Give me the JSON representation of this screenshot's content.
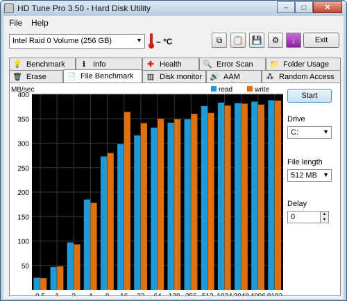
{
  "window": {
    "title": "HD Tune Pro 3.50 - Hard Disk Utility",
    "minimize": "–",
    "maximize": "□",
    "close": "✕"
  },
  "menu": [
    {
      "label": "File"
    },
    {
      "label": "Help"
    }
  ],
  "toolbar": {
    "drive": "Intel   Raid 0 Volume (256 GB)",
    "temperature": "– °C",
    "exit_label": "Exit"
  },
  "tabs_top": [
    {
      "label": "Benchmark",
      "icon": "lightbulb-icon"
    },
    {
      "label": "Info",
      "icon": "info-icon"
    },
    {
      "label": "Health",
      "icon": "health-cross-icon"
    },
    {
      "label": "Error Scan",
      "icon": "magnifier-icon"
    },
    {
      "label": "Folder Usage",
      "icon": "folder-icon"
    }
  ],
  "tabs_bottom": [
    {
      "label": "Erase",
      "icon": "trash-icon"
    },
    {
      "label": "File Benchmark",
      "icon": "file-icon"
    },
    {
      "label": "Disk monitor",
      "icon": "monitor-icon"
    },
    {
      "label": "AAM",
      "icon": "speaker-icon"
    },
    {
      "label": "Random Access",
      "icon": "random-icon"
    }
  ],
  "active_tab": "File Benchmark",
  "controls": {
    "start_label": "Start",
    "drive_label": "Drive",
    "drive_value": "C:",
    "file_length_label": "File length",
    "file_length_value": "512 MB",
    "delay_label": "Delay",
    "delay_value": "0"
  },
  "colors": {
    "read": "#1e9ad6",
    "write": "#e0700d",
    "plot_bg": "#000000"
  },
  "chart_data": {
    "type": "bar",
    "ylabel": "MB/sec",
    "ylim": [
      0,
      400
    ],
    "yticks": [
      50,
      100,
      150,
      200,
      250,
      300,
      350,
      400
    ],
    "categories": [
      "0.5",
      "1",
      "2",
      "4",
      "8",
      "16",
      "32",
      "64",
      "128",
      "256",
      "512",
      "1024",
      "2048",
      "4096",
      "8192"
    ],
    "series": [
      {
        "name": "read",
        "values": [
          25,
          47,
          97,
          185,
          273,
          298,
          316,
          332,
          342,
          349,
          376,
          383,
          382,
          385,
          388
        ]
      },
      {
        "name": "write",
        "values": [
          24,
          48,
          93,
          178,
          280,
          364,
          341,
          350,
          349,
          360,
          362,
          377,
          381,
          379,
          387
        ]
      }
    ],
    "legend": "top-right",
    "grid": true
  }
}
